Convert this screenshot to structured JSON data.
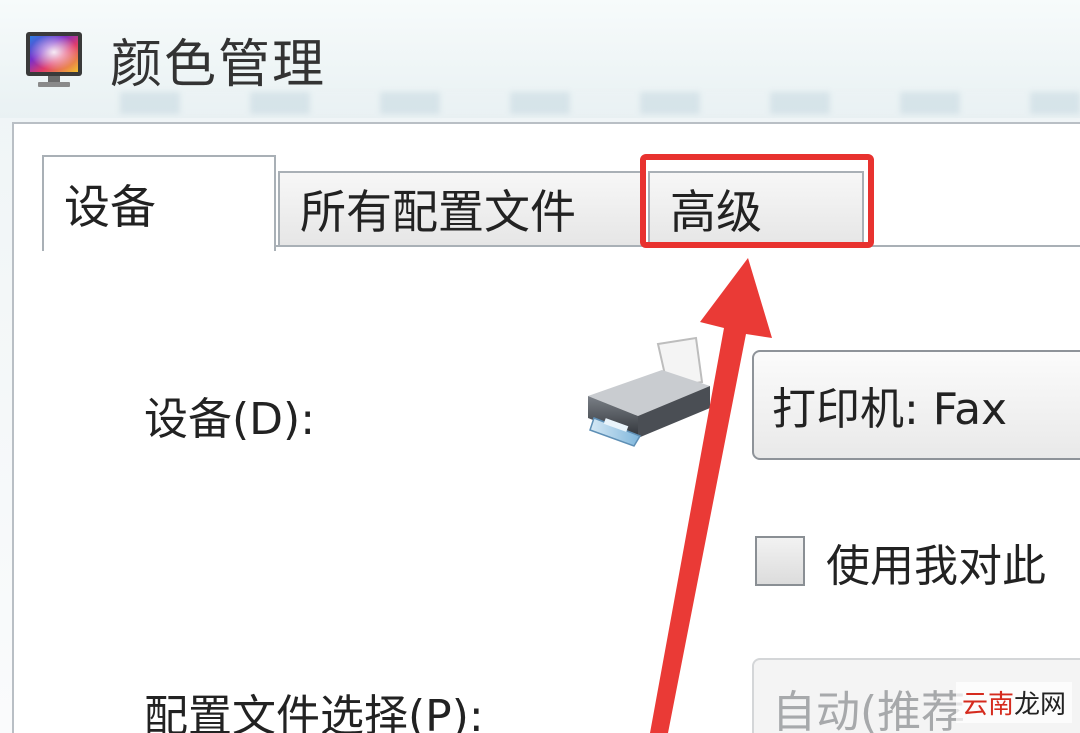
{
  "window": {
    "title": "颜色管理",
    "icon": "color-management-monitor-icon"
  },
  "tabs": [
    {
      "label": "设备",
      "active": true
    },
    {
      "label": "所有配置文件",
      "active": false
    },
    {
      "label": "高级",
      "active": false
    }
  ],
  "device_section": {
    "label": "设备(D):",
    "device_icon": "printer-icon",
    "dropdown_value": "打印机: Fax"
  },
  "checkbox": {
    "label": "使用我对此",
    "checked": false
  },
  "profile_section": {
    "label": "配置文件选择(P):",
    "dropdown_value": "自动(推荐"
  },
  "annotation": {
    "highlight_color": "#e8322f"
  },
  "watermark": {
    "part1": "云南",
    "part2": "龙网"
  }
}
